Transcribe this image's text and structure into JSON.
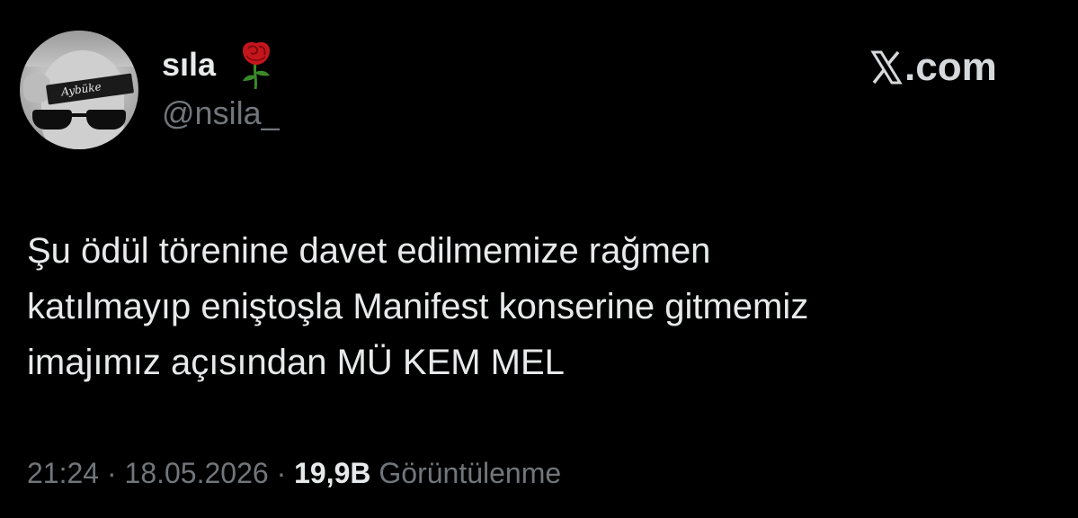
{
  "user": {
    "display_name": "sıla",
    "handle": "@nsila_",
    "avatar_gum_text": "Aybüke",
    "name_emoji": "rose-icon"
  },
  "brand": {
    "text": ".com",
    "icon": "x-logo-icon"
  },
  "tweet": {
    "lines": [
      "Şu ödül törenine davet edilmemize rağmen",
      "katılmayıp eniştoşla Manifest konserine gitmemiz",
      "imajımız açısından MÜ KEM MEL"
    ]
  },
  "meta": {
    "time": "21:24",
    "separator": " · ",
    "date": "18.05.2026",
    "views_count": "19,9B",
    "views_label": "Görüntülenme"
  },
  "colors": {
    "background": "#000000",
    "primary_text": "#e7e9ea",
    "secondary_text": "#71767b",
    "rose_red": "#c4161c",
    "rose_green": "#3a8a2a"
  }
}
